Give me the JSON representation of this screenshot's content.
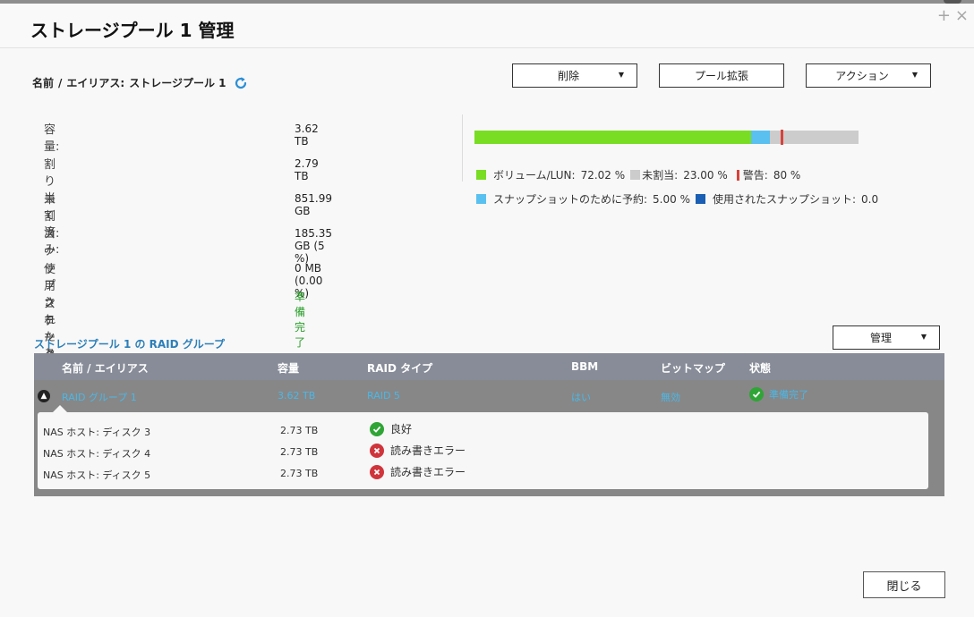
{
  "dialog": {
    "title": "ストレージプール 1 管理",
    "win_plus": "+",
    "win_close": "×"
  },
  "name_row": {
    "label": "名前",
    "sep": "/",
    "alias_label": "エイリアス:",
    "value": "ストレージプール 1"
  },
  "buttons": {
    "delete": "削除",
    "expand": "プール拡張",
    "action": "アクション",
    "manage": "管理",
    "close": "閉じる"
  },
  "properties": [
    {
      "label": "容量:",
      "value": "3.62 TB"
    },
    {
      "label": "割り当て済み:",
      "value": "2.79 TB"
    },
    {
      "label": "未割当:",
      "value": "851.99 GB"
    },
    {
      "label": "スナップショットのために予約:",
      "value": "185.35 GB (5 %)"
    },
    {
      "label": "使用されたスナップショット:",
      "value": "0 MB (0.00 %)"
    },
    {
      "label": "ステータス:",
      "value": "準備完了"
    }
  ],
  "usage": {
    "volume_pct": 72.02,
    "snapshot_pct": 5.0,
    "unallocated_pct": 23.0,
    "warning_pct": 80,
    "colors": {
      "volume": "#78dd23",
      "unallocated": "#cccccc",
      "warning": "#d9423a",
      "snapshot_reserved": "#5ac0f0",
      "snapshot_used": "#1a5fb4"
    },
    "legend": {
      "volume_label": "ボリューム/LUN:",
      "volume_value": "72.02 %",
      "unallocated_label": "未割当:",
      "unallocated_value": "23.00 %",
      "warning_label": "警告:",
      "warning_value": "80 %",
      "snapshot_reserved_label": "スナップショットのために予約:",
      "snapshot_reserved_value": "5.00 %",
      "snapshot_used_label": "使用されたスナップショット:",
      "snapshot_used_value": "0.0"
    }
  },
  "raid_section": {
    "title": "ストレージプール 1 の RAID グループ",
    "columns": [
      "名前 / エイリアス",
      "容量",
      "RAID タイプ",
      "BBM",
      "ビットマップ",
      "状態"
    ],
    "group": {
      "name": "RAID グループ 1",
      "capacity": "3.62 TB",
      "raid_type": "RAID 5",
      "bbm": "はい",
      "bitmap": "無効",
      "status": "準備完了"
    },
    "disks": [
      {
        "name": "NAS ホスト: ディスク 3",
        "capacity": "2.73 TB",
        "status": "良好",
        "state": "ok"
      },
      {
        "name": "NAS ホスト: ディスク 4",
        "capacity": "2.73 TB",
        "status": "読み書きエラー",
        "state": "error"
      },
      {
        "name": "NAS ホスト: ディスク 5",
        "capacity": "2.73 TB",
        "status": "読み書きエラー",
        "state": "error"
      }
    ]
  }
}
